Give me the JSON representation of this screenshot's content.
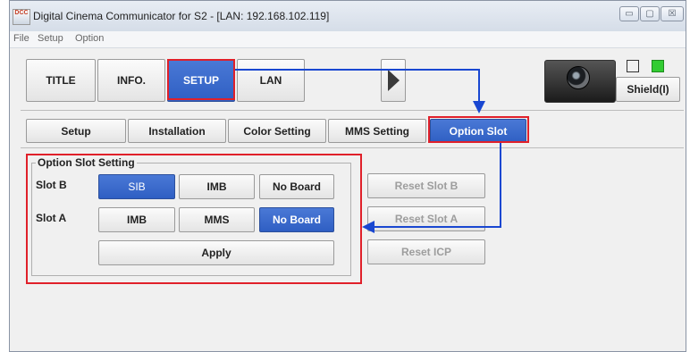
{
  "window": {
    "title": "Digital Cinema Communicator for S2 - [LAN: 192.168.102.119]",
    "icon_text": "DCC",
    "controls": [
      "▭",
      "▢",
      "☒"
    ]
  },
  "menu": [
    "File",
    "Setup",
    "Option"
  ],
  "top_tabs": [
    {
      "label": "TITLE",
      "active": false
    },
    {
      "label": "INFO.",
      "active": false
    },
    {
      "label": "SETUP",
      "active": true
    },
    {
      "label": "LAN",
      "active": false
    }
  ],
  "play_icon": "play-triangle-icon",
  "shield_button": "Shield(I)",
  "indicators": {
    "left_color": "#ffffff",
    "right_color": "#33cc33"
  },
  "sub_tabs": [
    {
      "label": "Setup",
      "active": false
    },
    {
      "label": "Installation",
      "active": false
    },
    {
      "label": "Color Setting",
      "active": false
    },
    {
      "label": "MMS Setting",
      "active": false
    },
    {
      "label": "Option Slot",
      "active": true
    }
  ],
  "option_slot": {
    "group_title": "Option Slot Setting",
    "slot_b": {
      "label": "Slot B",
      "options": [
        "SIB",
        "IMB",
        "No Board"
      ],
      "selected": "SIB"
    },
    "slot_a": {
      "label": "Slot A",
      "options": [
        "IMB",
        "MMS",
        "No Board"
      ],
      "selected": "No Board"
    },
    "apply": "Apply"
  },
  "reset_buttons": [
    "Reset Slot B",
    "Reset Slot A",
    "Reset ICP"
  ],
  "colors": {
    "accent_blue": "#2f5fc3",
    "highlight_red": "#e0202a",
    "arrow_blue": "#1947d1"
  }
}
